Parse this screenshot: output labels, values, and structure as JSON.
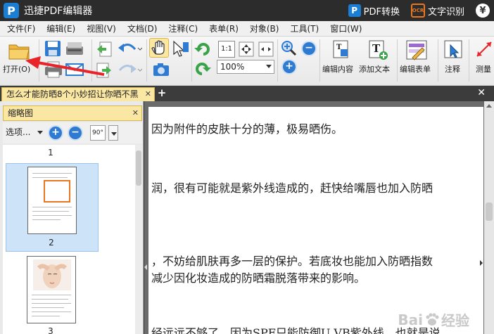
{
  "app": {
    "title": "迅捷PDF编辑器",
    "logo_letter": "P"
  },
  "title_actions": {
    "pdf_convert": "PDF转换",
    "ocr_badge": "OCR",
    "ocr": "文字识别",
    "currency": "¥"
  },
  "menu": [
    "文件(F)",
    "编辑(E)",
    "视图(V)",
    "文档(D)",
    "注释(C)",
    "表单(R)",
    "对象(B)",
    "工具(T)",
    "窗口(W)"
  ],
  "toolbar": {
    "open_label": "打开(O)",
    "zoom_value": "100%",
    "actual_size_label": "1:1",
    "edit_content": "编辑内容",
    "add_text": "添加文本",
    "edit_form": "编辑表单",
    "annotate": "注释",
    "measure": "测量"
  },
  "tab": {
    "title": "怎么才能防晒8个小妙招让你晒不黑",
    "close": "✕",
    "new": "+",
    "close_all": "✕"
  },
  "panel": {
    "title": "缩略图",
    "close": "✕",
    "options": "选项...",
    "rotate_label": "90°",
    "pages": [
      {
        "num": "1"
      },
      {
        "num": "2"
      },
      {
        "num": "3"
      }
    ]
  },
  "document": {
    "lines": [
      "因为附件的皮肤十分的薄，极易晒伤。",
      "润，很有可能就是紫外线造成的，赶快给嘴唇也加入防晒",
      "，不妨给肌肤再多一层的保护。若底妆也能加入防晒指数",
      "减少因化妆造成的防晒霜脱落带来的影响。",
      "经远远不够了，因为SPF只能防御U VB紫外线，也就是说"
    ]
  },
  "watermark": {
    "brand": "Bai",
    "brand2": "经验"
  },
  "colors": {
    "accent": "#2f7bd1",
    "tab_active": "#fbe7a4",
    "titlebar": "#2c2c2c",
    "annotation": "#e8232a"
  }
}
